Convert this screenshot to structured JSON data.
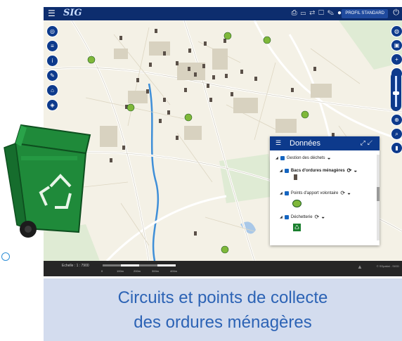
{
  "app": {
    "logo_text": "SIG",
    "menu_icon": "hamburger-icon"
  },
  "toolbar": {
    "tools": [
      "print-icon",
      "keyboard-icon",
      "translate-icon",
      "clipboard-icon",
      "pencil-icon",
      "shapes-icon",
      "export-icon"
    ],
    "profile_label": "PROFIL STANDARD",
    "power_icon": "power-icon"
  },
  "left_controls": [
    "locate-icon",
    "list-icon",
    "info-icon",
    "wrench-icon",
    "home-icon",
    "layers-icon"
  ],
  "right_controls_top": [
    "globe-icon",
    "image-icon",
    "zoom-in-icon",
    "zoom-out-icon"
  ],
  "zoom": {
    "level": 0.45
  },
  "right_controls_bottom": [
    "zoom-area-icon",
    "search-icon",
    "bookmark-icon"
  ],
  "panel": {
    "title": "Données",
    "layers": [
      {
        "label": "Gestion des déchets",
        "bold": false,
        "indent": 0
      },
      {
        "label": "Bacs d'ordures ménagères",
        "bold": true,
        "indent": 1
      },
      {
        "label": "Points d'apport volontaire",
        "bold": false,
        "indent": 1
      },
      {
        "label": "Déchetterie",
        "bold": false,
        "indent": 1
      }
    ]
  },
  "footer": {
    "scale_label": "Echelle : 1 : 7900",
    "scale_ticks": [
      "0",
      "100m",
      "200m",
      "300m",
      "400m"
    ],
    "attribution": "© SSpatial - SIGD"
  },
  "caption": {
    "line1": "Circuits et points de collecte",
    "line2": "des ordures ménagères"
  },
  "colors": {
    "primary": "#0d3a8c",
    "topbar": "#0d2d6e",
    "caption_bg": "#d3dcee",
    "caption_text": "#2c63b5",
    "bin_green": "#1f8a3a"
  }
}
